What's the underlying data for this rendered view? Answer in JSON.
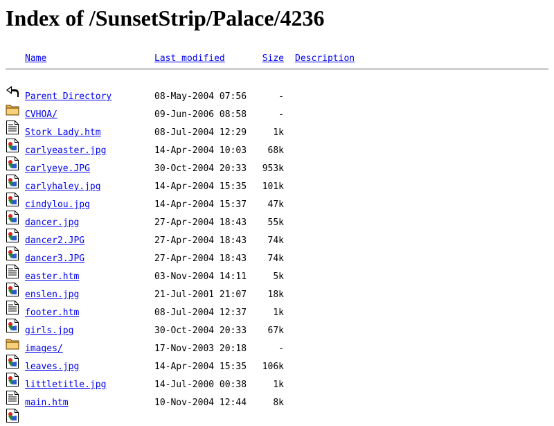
{
  "page": {
    "title": "Index of /SunsetStrip/Palace/4236"
  },
  "columns": {
    "name": "Name",
    "modified": "Last modified",
    "size": "Size",
    "description": "Description"
  },
  "entries": [
    {
      "icon": "back-icon",
      "name": "Parent Directory",
      "modified": "08-May-2004 07:56",
      "size": "-"
    },
    {
      "icon": "folder-icon",
      "name": "CVHOA/",
      "modified": "09-Jun-2006 08:58",
      "size": "-"
    },
    {
      "icon": "text-file-icon",
      "name": "Stork Lady.htm",
      "modified": "08-Jul-2004 12:29",
      "size": "1k"
    },
    {
      "icon": "image-file-icon",
      "name": "carlyeaster.jpg",
      "modified": "14-Apr-2004 10:03",
      "size": "68k"
    },
    {
      "icon": "image-file-icon",
      "name": "carlyeye.JPG",
      "modified": "30-Oct-2004 20:33",
      "size": "953k"
    },
    {
      "icon": "image-file-icon",
      "name": "carlyhaley.jpg",
      "modified": "14-Apr-2004 15:35",
      "size": "101k"
    },
    {
      "icon": "image-file-icon",
      "name": "cindylou.jpg",
      "modified": "14-Apr-2004 15:37",
      "size": "47k"
    },
    {
      "icon": "image-file-icon",
      "name": "dancer.jpg",
      "modified": "27-Apr-2004 18:43",
      "size": "55k"
    },
    {
      "icon": "image-file-icon",
      "name": "dancer2.JPG",
      "modified": "27-Apr-2004 18:43",
      "size": "74k"
    },
    {
      "icon": "image-file-icon",
      "name": "dancer3.JPG",
      "modified": "27-Apr-2004 18:43",
      "size": "74k"
    },
    {
      "icon": "text-file-icon",
      "name": "easter.htm",
      "modified": "03-Nov-2004 14:11",
      "size": "5k"
    },
    {
      "icon": "image-file-icon",
      "name": "enslen.jpg",
      "modified": "21-Jul-2001 21:07",
      "size": "18k"
    },
    {
      "icon": "text-file-icon",
      "name": "footer.htm",
      "modified": "08-Jul-2004 12:37",
      "size": "1k"
    },
    {
      "icon": "image-file-icon",
      "name": "girls.jpg",
      "modified": "30-Oct-2004 20:33",
      "size": "67k"
    },
    {
      "icon": "folder-icon",
      "name": "images/",
      "modified": "17-Nov-2003 20:18",
      "size": "-"
    },
    {
      "icon": "image-file-icon",
      "name": "leaves.jpg",
      "modified": "14-Apr-2004 15:35",
      "size": "106k"
    },
    {
      "icon": "image-file-icon",
      "name": "littletitle.jpg",
      "modified": "14-Jul-2000 00:38",
      "size": "1k"
    },
    {
      "icon": "text-file-icon",
      "name": "main.htm",
      "modified": "10-Nov-2004 12:44",
      "size": "8k"
    },
    {
      "icon": "image-file-icon",
      "name": "",
      "modified": "",
      "size": ""
    }
  ]
}
